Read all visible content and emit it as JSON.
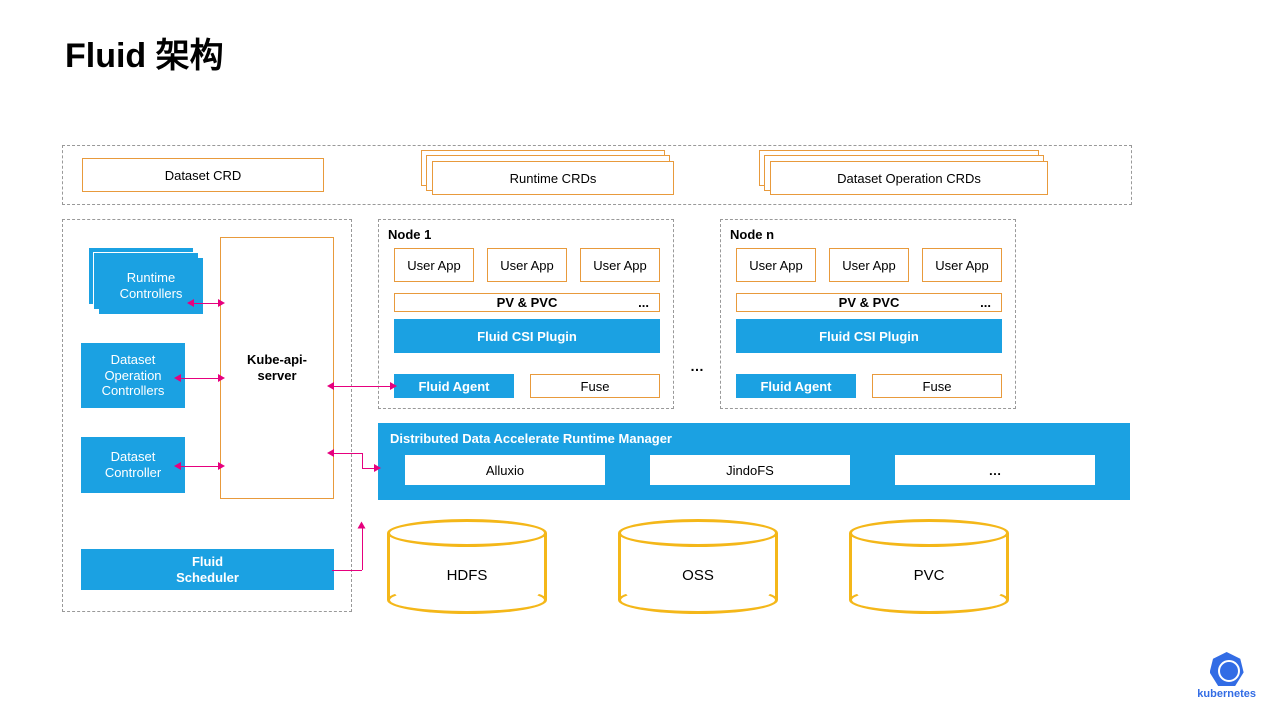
{
  "title": "Fluid 架构",
  "crd_row": {
    "dataset": "Dataset CRD",
    "runtime": "Runtime CRDs",
    "dataset_op": "Dataset Operation CRDs"
  },
  "left_panel": {
    "runtime_controllers": "Runtime\nControllers",
    "dataset_op_controllers": "Dataset\nOperation\nControllers",
    "dataset_controller": "Dataset\nController",
    "kube_api": "Kube-api-\nserver",
    "fluid_scheduler": "Fluid\nScheduler"
  },
  "node": {
    "n1_label": "Node 1",
    "nn_label": "Node n",
    "user_app": "User App",
    "pvpvc": "PV & PVC",
    "pvpvc_ellipsis": "...",
    "csi": "Fluid CSI Plugin",
    "agent": "Fluid Agent",
    "fuse": "Fuse",
    "between": "…"
  },
  "runtime_mgr": {
    "title": "Distributed  Data Accelerate Runtime Manager",
    "alluxio": "Alluxio",
    "jindofs": "JindoFS",
    "more": "…"
  },
  "storage": {
    "hdfs": "HDFS",
    "oss": "OSS",
    "pvc": "PVC"
  },
  "k8s": "kubernetes"
}
